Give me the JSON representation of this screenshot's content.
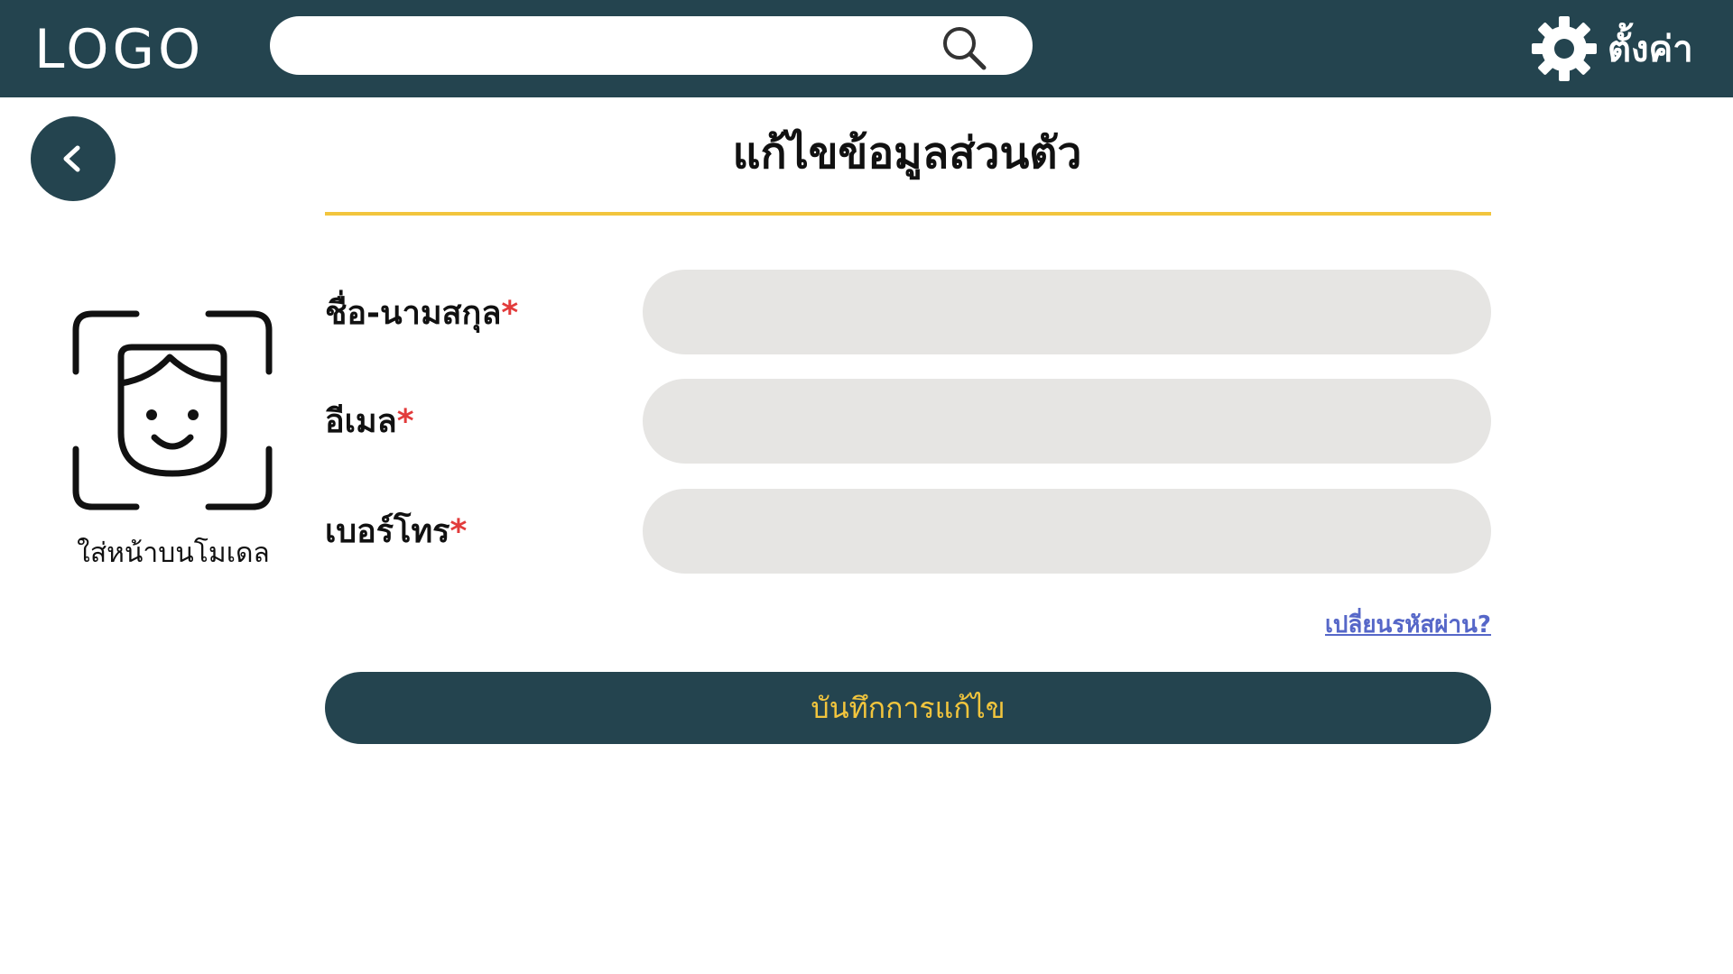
{
  "header": {
    "logo_text": "LOGO",
    "search": {
      "value": "",
      "placeholder": ""
    },
    "settings_label": "ตั้งค่า"
  },
  "page": {
    "title": "แก้ไขข้อมูลส่วนตัว"
  },
  "avatar": {
    "caption": "ใส่หน้าบนโมเดล"
  },
  "form": {
    "fields": [
      {
        "label": "ชื่อ-นามสกุล",
        "required_mark": "*",
        "value": ""
      },
      {
        "label": "อีเมล",
        "required_mark": "*",
        "value": ""
      },
      {
        "label": "เบอร์โทร",
        "required_mark": "*",
        "value": ""
      }
    ],
    "change_password_link": "เปลี่ยนรหัสผ่าน?",
    "save_button_label": "บันทึกการแก้ไข"
  },
  "colors": {
    "primary": "#24444f",
    "accent": "#f2c53d",
    "required": "#e23b3b",
    "input_bg": "#e6e5e3",
    "link": "#5667c8"
  },
  "icons": [
    "search-icon",
    "gear-icon",
    "chevron-left-icon",
    "face-scan-icon"
  ]
}
